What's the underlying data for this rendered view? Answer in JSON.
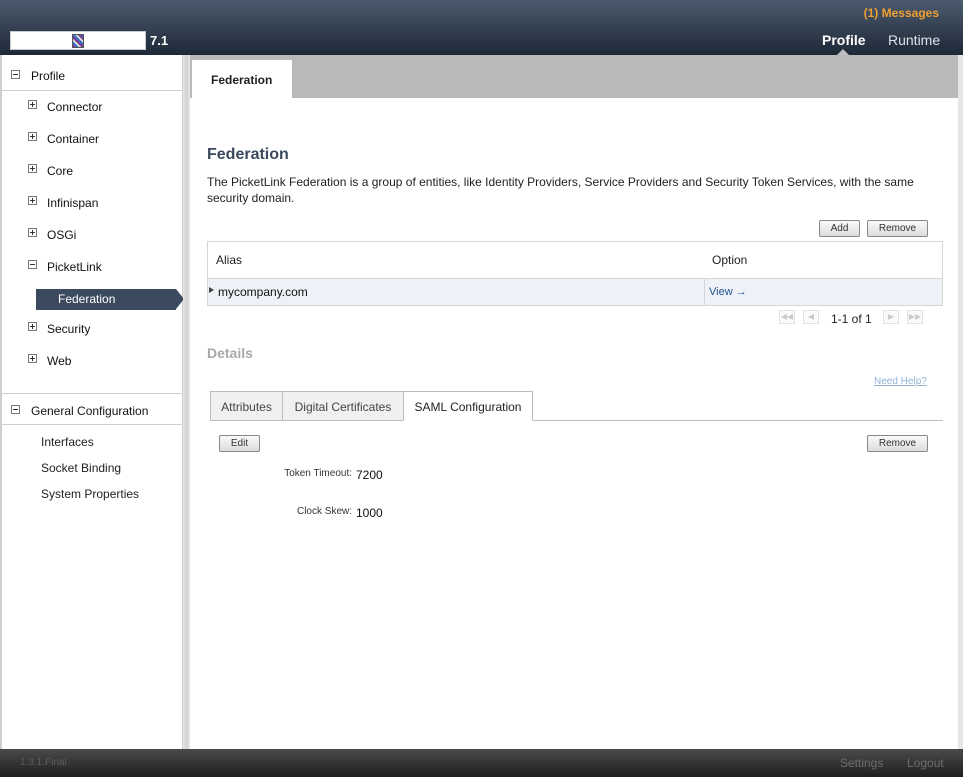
{
  "header": {
    "messages": "(1) Messages",
    "version": "7.1",
    "nav": {
      "profile": "Profile",
      "runtime": "Runtime"
    }
  },
  "sidebar": {
    "profile_section": "Profile",
    "items": [
      {
        "label": "Connector",
        "icon": "plus-icon"
      },
      {
        "label": "Container",
        "icon": "plus-icon"
      },
      {
        "label": "Core",
        "icon": "plus-icon"
      },
      {
        "label": "Infinispan",
        "icon": "plus-icon"
      },
      {
        "label": "OSGi",
        "icon": "plus-icon"
      },
      {
        "label": "PicketLink",
        "icon": "minus-icon"
      },
      {
        "label": "Security",
        "icon": "plus-icon"
      },
      {
        "label": "Web",
        "icon": "plus-icon"
      }
    ],
    "selected_child": "Federation",
    "general_section": "General Configuration",
    "general_items": [
      "Interfaces",
      "Socket Binding",
      "System Properties"
    ]
  },
  "main": {
    "tab": "Federation",
    "title": "Federation",
    "description": "The PicketLink Federation is a group of entities, like Identity Providers, Service Providers and Security Token Services, with the same security domain.",
    "add_button": "Add",
    "remove_button": "Remove",
    "table": {
      "columns": [
        "Alias",
        "Option"
      ],
      "rows": [
        {
          "alias": "mycompany.com",
          "option": "View →"
        }
      ]
    },
    "pager": {
      "label": "1-1 of 1"
    },
    "details_title": "Details",
    "need_help": "Need Help?",
    "subtabs": [
      "Attributes",
      "Digital Certificates",
      "SAML Configuration"
    ],
    "active_subtab": "SAML Configuration",
    "edit_button": "Edit",
    "detail_remove_button": "Remove",
    "fields": [
      {
        "label": "Token Timeout:",
        "value": "7200"
      },
      {
        "label": "Clock Skew:",
        "value": "1000"
      }
    ]
  },
  "footer": {
    "version": "1.3.1.Final",
    "settings": "Settings",
    "logout": "Logout"
  },
  "colors": {
    "accent": "#f0a030",
    "selection": "#3b4a5e",
    "link": "#1f4f8f"
  }
}
